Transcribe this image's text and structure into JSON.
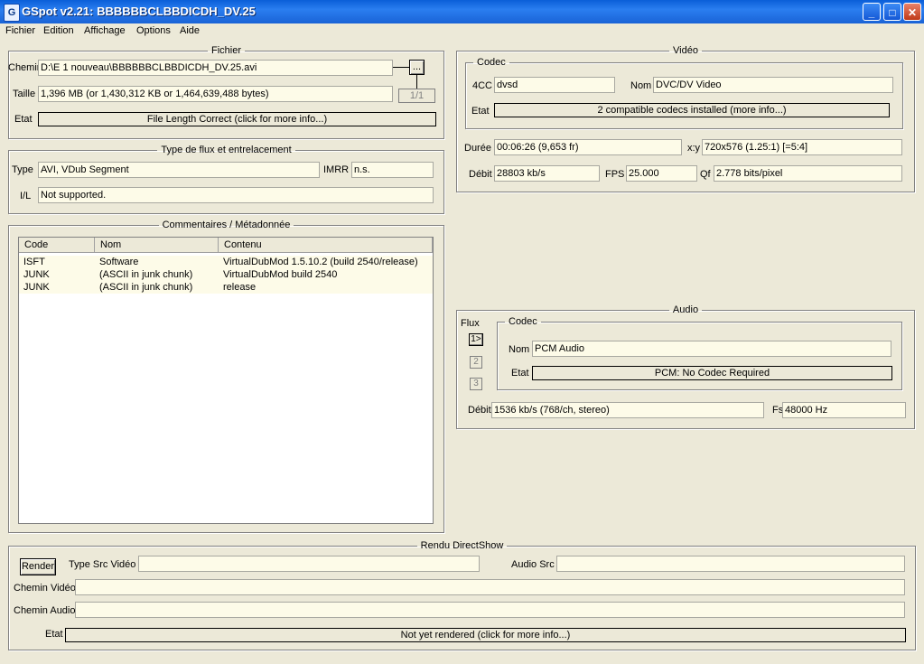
{
  "window": {
    "icon": "gspot-icon",
    "title": "GSpot v2.21: BBBBBBCLBBDICDH_DV.25",
    "minimize": "_",
    "maximize": "□",
    "close": "✕"
  },
  "menu": [
    "Fichier",
    "Edition",
    "Affichage",
    "Options",
    "Aide"
  ],
  "fichier": {
    "legend": "Fichier",
    "chemin_label": "Chemin",
    "chemin_value": "D:\\E 1 nouveau\\BBBBBBCLBBDICDH_DV.25.avi",
    "browse_label": "...",
    "taille_label": "Taille",
    "taille_value": "1,396 MB (or 1,430,312 KB or 1,464,639,488 bytes)",
    "page_indicator": "1/1",
    "etat_label": "Etat",
    "etat_value": "File Length Correct (click for more info...)"
  },
  "flux": {
    "legend": "Type de flux et entrelacement",
    "type_label": "Type",
    "type_value": "AVI, VDub Segment",
    "imrr_label": "IMRR",
    "imrr_value": "n.s.",
    "il_label": "I/L",
    "il_value": "Not supported."
  },
  "comments": {
    "legend": "Commentaires / Métadonnée",
    "columns": [
      "Code",
      "Nom",
      "Contenu"
    ],
    "rows": [
      {
        "code": "ISFT",
        "nom": "Software",
        "contenu": "VirtualDubMod 1.5.10.2 (build 2540/release)"
      },
      {
        "code": "JUNK",
        "nom": "(ASCII in junk chunk)",
        "contenu": "VirtualDubMod build 2540"
      },
      {
        "code": "JUNK",
        "nom": "(ASCII in junk chunk)",
        "contenu": "release"
      }
    ]
  },
  "video": {
    "legend": "Vidéo",
    "codec_legend": "Codec",
    "fourcc_label": "4CC",
    "fourcc_value": "dvsd",
    "nom_label": "Nom",
    "nom_value": "DVC/DV Video",
    "etat_label": "Etat",
    "etat_value": "2 compatible codecs installed (more info...)",
    "duree_label": "Durée",
    "duree_value": "00:06:26 (9,653 fr)",
    "xy_label": "x:y",
    "xy_value": "720x576 (1.25:1) [=5:4]",
    "debit_label": "Débit",
    "debit_value": "28803 kb/s",
    "fps_label": "FPS",
    "fps_value": "25.000",
    "qf_label": "Qf",
    "qf_value": "2.778 bits/pixel"
  },
  "audio": {
    "legend": "Audio",
    "flux_label": "Flux",
    "streams": [
      "1>",
      "2",
      "3"
    ],
    "codec_legend": "Codec",
    "nom_label": "Nom",
    "nom_value": "PCM Audio",
    "etat_label": "Etat",
    "etat_value": "PCM: No Codec Required",
    "debit_label": "Débit",
    "debit_value": "1536 kb/s (768/ch, stereo)",
    "fs_label": "Fs",
    "fs_value": "48000 Hz"
  },
  "render": {
    "legend": "Rendu DirectShow",
    "render_button": "Render",
    "type_src_label": "Type Src Vidéo",
    "type_src_value": "",
    "audio_src_label": "Audio Src",
    "audio_src_value": "",
    "chemin_video_label": "Chemin Vidéo",
    "chemin_video_value": "",
    "chemin_audio_label": "Chemin Audio",
    "chemin_audio_value": "",
    "etat_label": "Etat",
    "etat_value": "Not yet rendered (click for more info...)"
  }
}
